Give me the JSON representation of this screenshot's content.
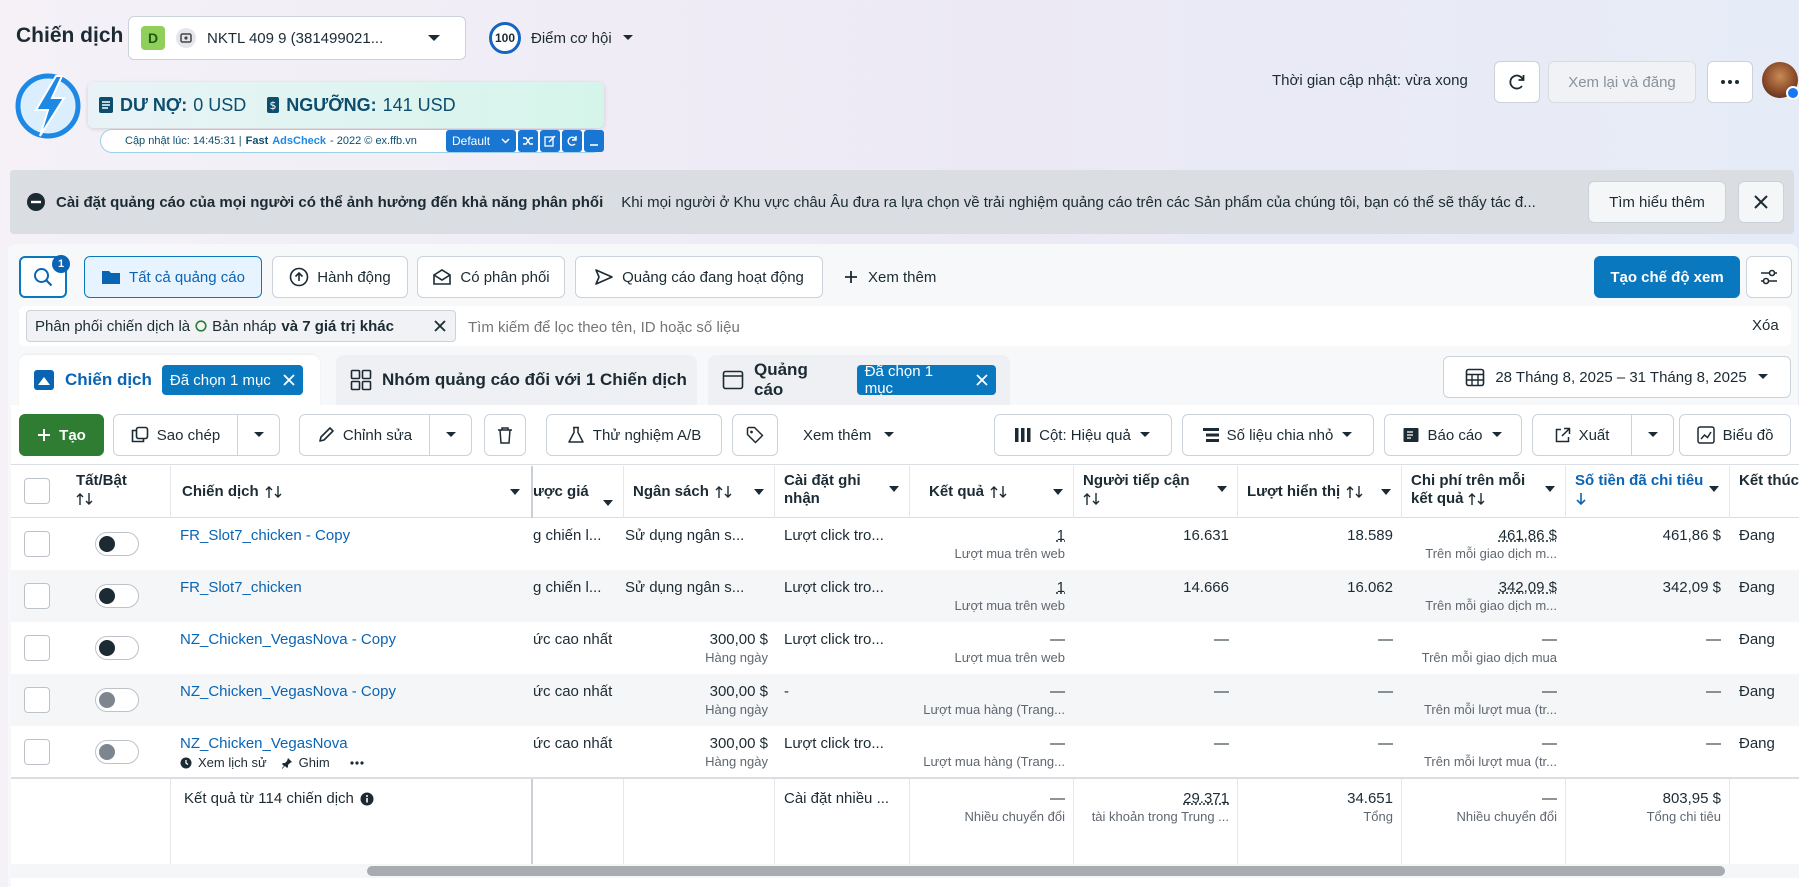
{
  "header": {
    "title": "Chiến dịch",
    "account_badge": "D",
    "account_name": "NKTL 409 9 (381499021...",
    "score": "100",
    "score_label": "Điểm cơ hội",
    "update_time": "Thời gian cập nhật: vừa xong",
    "review_button": "Xem lại và đăng"
  },
  "adscheck": {
    "debt_label": "DƯ NỢ:",
    "debt_value": "0 USD",
    "threshold_label": "NGƯỠNG:",
    "threshold_value": "141 USD",
    "updated": "Cập nhật lúc: 14:45:31 |",
    "brand_fast": "Fast",
    "brand_name": "AdsCheck",
    "copyright": "- 2022 © ex.ffb.vn",
    "select_value": "Default"
  },
  "banner": {
    "title": "Cài đặt quảng cáo của mọi người có thể ảnh hưởng đến khả năng phân phối",
    "text": "Khi mọi người ở Khu vực châu Âu đưa ra lựa chọn về trải nghiệm quảng cáo trên các Sản phẩm của chúng tôi, bạn có thể sẽ thấy tác đ...",
    "learn_more": "Tìm hiểu thêm"
  },
  "filters": {
    "search_badge": "1",
    "all_ads": "Tất cả quảng cáo",
    "actions": "Hành động",
    "delivery": "Có phân phối",
    "active_ads": "Quảng cáo đang hoạt động",
    "see_more": "Xem thêm",
    "create_view": "Tạo chế độ xem"
  },
  "filter_bar": {
    "chip_prefix": "Phân phối chiến dịch là",
    "chip_value": "Bản nháp",
    "chip_suffix": "và 7 giá trị khác",
    "search_placeholder": "Tìm kiếm để lọc theo tên, ID hoặc số liệu",
    "clear": "Xóa"
  },
  "tabs": {
    "campaign": "Chiến dịch",
    "campaign_selected": "Đã chọn 1 mục",
    "adsets": "Nhóm quảng cáo đối với 1 Chiến dịch",
    "ads": "Quảng cáo",
    "ads_selected": "Đã chọn 1 mục",
    "date_range": "28 Tháng 8, 2025 – 31 Tháng 8, 2025"
  },
  "toolbar": {
    "create": "Tạo",
    "copy": "Sao chép",
    "edit": "Chỉnh sửa",
    "ab_test": "Thử nghiệm A/B",
    "more": "Xem thêm",
    "columns": "Cột: Hiệu quả",
    "breakdown": "Số liệu chia nhỏ",
    "reports": "Báo cáo",
    "export": "Xuất",
    "charts": "Biểu đồ"
  },
  "table": {
    "headers": {
      "toggle": "Tất/Bật",
      "campaign": "Chiến dịch",
      "bid": "ược giá",
      "budget": "Ngân sách",
      "attribution": "Cài đặt ghi nhận",
      "results": "Kết quả",
      "reach": "Người tiếp cận",
      "impressions": "Lượt hiển thị",
      "cpr": "Chi phí trên mỗi kết quả",
      "spent": "Số tiền đã chi tiêu",
      "ends": "Kết thúc"
    },
    "rows": [
      {
        "name": "FR_Slot7_chicken - Copy",
        "bid": "g chiến l...",
        "budget": "Sử dụng ngân s...",
        "budget_sub": "",
        "attr": "Lượt click tro...",
        "result": "1",
        "result_sub": "Lượt mua trên web",
        "reach": "16.631",
        "impr": "18.589",
        "cpr": "461,86 $",
        "cpr_sub": "Trên mỗi giao dịch m...",
        "spent": "461,86 $",
        "end": "Đang",
        "on": true
      },
      {
        "name": "FR_Slot7_chicken",
        "bid": "g chiến l...",
        "budget": "Sử dụng ngân s...",
        "budget_sub": "",
        "attr": "Lượt click tro...",
        "result": "1",
        "result_sub": "Lượt mua trên web",
        "reach": "14.666",
        "impr": "16.062",
        "cpr": "342,09 $",
        "cpr_sub": "Trên mỗi giao dịch m...",
        "spent": "342,09 $",
        "end": "Đang",
        "on": true
      },
      {
        "name": "NZ_Chicken_VegasNova - Copy",
        "bid": "ức cao nhất",
        "budget": "300,00 $",
        "budget_sub": "Hàng ngày",
        "attr": "Lượt click tro...",
        "result": "—",
        "result_sub": "Lượt mua trên web",
        "reach": "—",
        "impr": "—",
        "cpr": "—",
        "cpr_sub": "Trên mỗi giao dịch mua",
        "spent": "—",
        "end": "Đang",
        "on": true
      },
      {
        "name": "NZ_Chicken_VegasNova - Copy",
        "bid": "ức cao nhất",
        "budget": "300,00 $",
        "budget_sub": "Hàng ngày",
        "attr": "-",
        "result": "—",
        "result_sub": "Lượt mua hàng (Trang...",
        "reach": "—",
        "impr": "—",
        "cpr": "—",
        "cpr_sub": "Trên mỗi lượt mua (tr...",
        "spent": "—",
        "end": "Đang",
        "on": false
      },
      {
        "name": "NZ_Chicken_VegasNova",
        "bid": "ức cao nhất",
        "budget": "300,00 $",
        "budget_sub": "Hàng ngày",
        "attr": "Lượt click tro...",
        "result": "—",
        "result_sub": "Lượt mua hàng (Trang...",
        "reach": "—",
        "impr": "—",
        "cpr": "—",
        "cpr_sub": "Trên mỗi lượt mua (tr...",
        "spent": "—",
        "end": "Đang",
        "on": false
      }
    ],
    "row_actions": {
      "history": "Xem lịch sử",
      "pin": "Ghim"
    },
    "footer": {
      "summary": "Kết quả từ 114 chiến dịch",
      "attr": "Cài đặt nhiều ...",
      "result": "—",
      "result_sub": "Nhiều chuyển đổi",
      "reach": "29.371",
      "reach_sub": "tài khoản trong Trung ...",
      "impr": "34.651",
      "impr_sub": "Tổng",
      "cpr": "—",
      "cpr_sub": "Nhiều chuyển đổi",
      "spent": "803,95 $",
      "spent_sub": "Tổng chi tiêu"
    }
  }
}
